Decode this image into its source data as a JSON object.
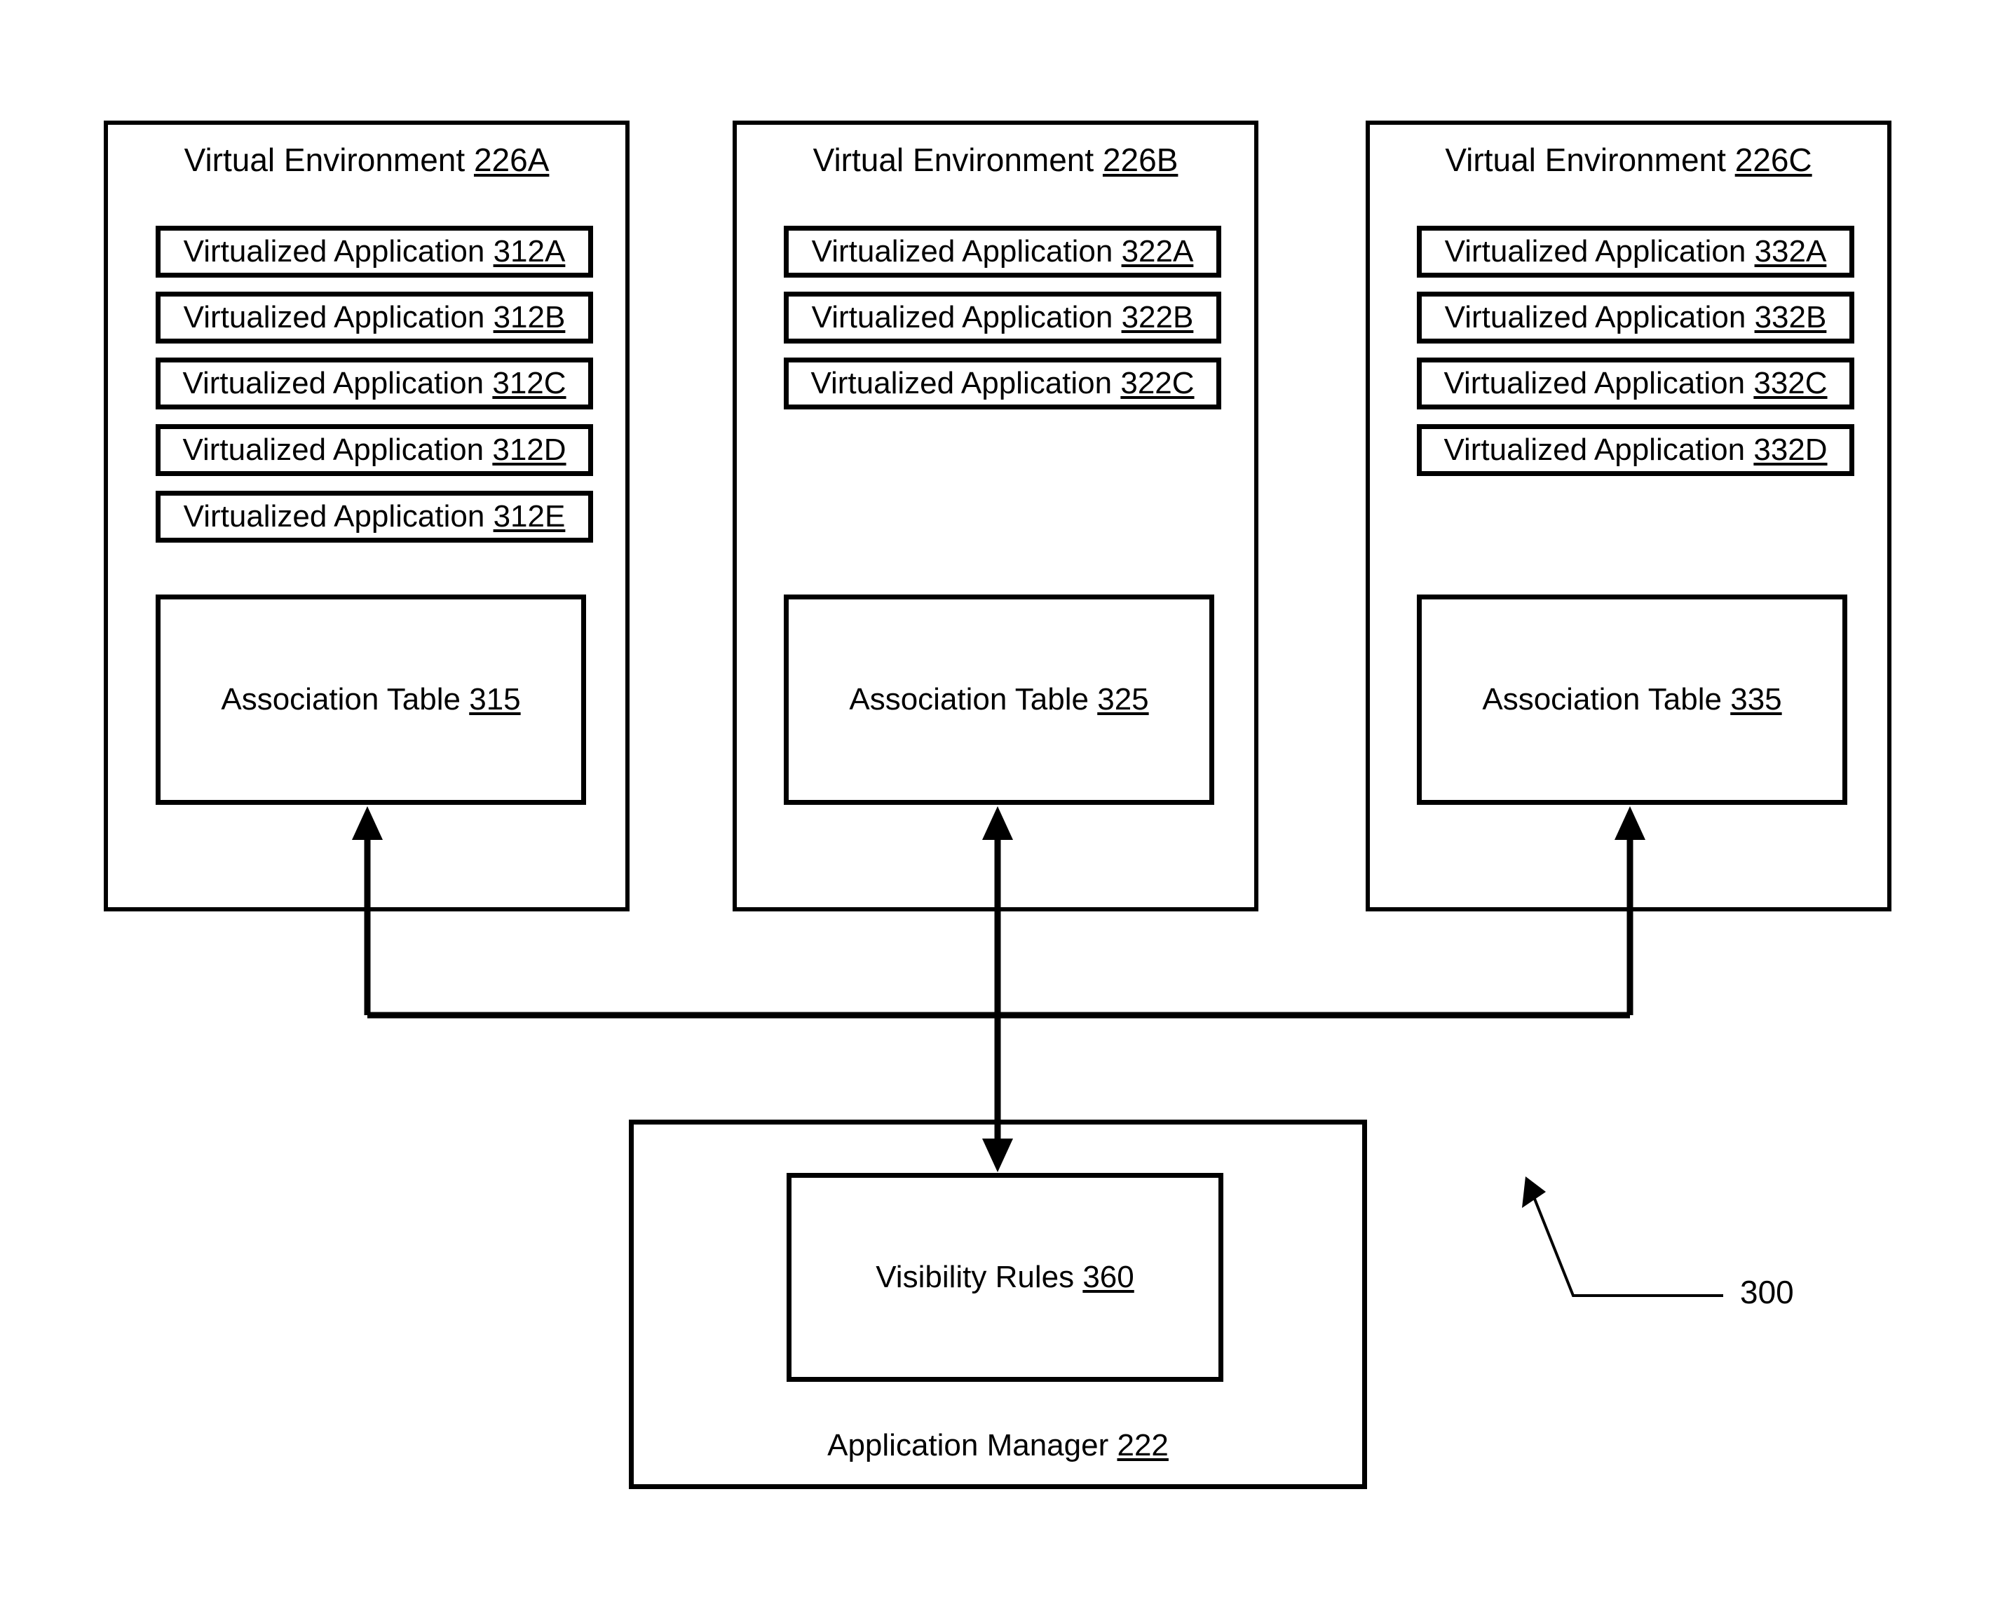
{
  "figure": {
    "reference_numeral": "300"
  },
  "environments": [
    {
      "title_text": "Virtual Environment ",
      "title_num": "226A",
      "applications": [
        {
          "text": "Virtualized Application ",
          "num": "312A"
        },
        {
          "text": "Virtualized Application ",
          "num": "312B"
        },
        {
          "text": "Virtualized Application ",
          "num": "312C"
        },
        {
          "text": "Virtualized Application ",
          "num": "312D"
        },
        {
          "text": "Virtualized Application ",
          "num": "312E"
        }
      ],
      "table": {
        "text": "Association Table ",
        "num": "315"
      }
    },
    {
      "title_text": "Virtual Environment ",
      "title_num": "226B",
      "applications": [
        {
          "text": "Virtualized Application ",
          "num": "322A"
        },
        {
          "text": "Virtualized Application ",
          "num": "322B"
        },
        {
          "text": "Virtualized Application ",
          "num": "322C"
        }
      ],
      "table": {
        "text": "Association Table ",
        "num": "325"
      }
    },
    {
      "title_text": "Virtual Environment ",
      "title_num": "226C",
      "applications": [
        {
          "text": "Virtualized Application ",
          "num": "332A"
        },
        {
          "text": "Virtualized Application ",
          "num": "332B"
        },
        {
          "text": "Virtualized Application ",
          "num": "332C"
        },
        {
          "text": "Virtualized Application ",
          "num": "332D"
        }
      ],
      "table": {
        "text": "Association Table ",
        "num": "335"
      }
    }
  ],
  "application_manager": {
    "label_text": "Application Manager ",
    "label_num": "222",
    "visibility_rules": {
      "text": "Visibility Rules ",
      "num": "360"
    }
  }
}
